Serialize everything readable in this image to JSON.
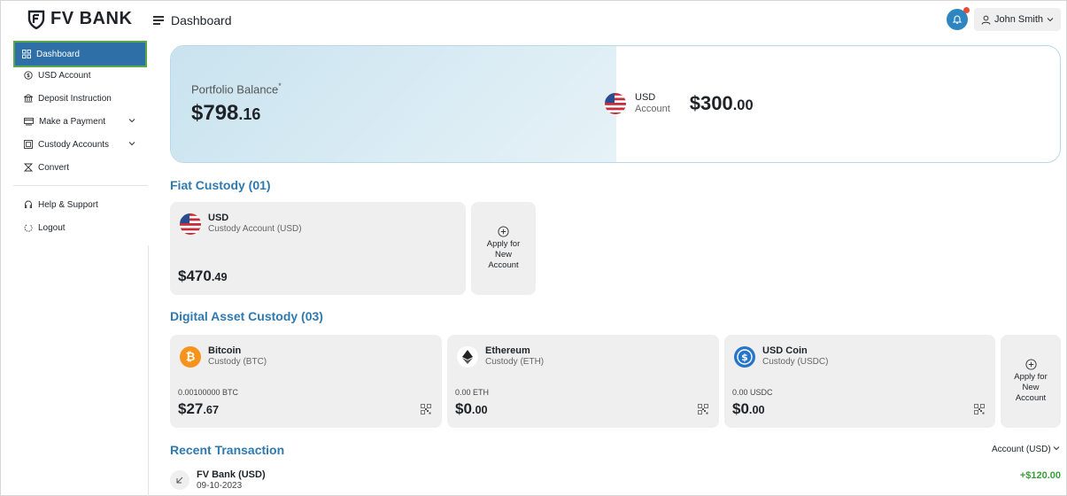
{
  "brand": {
    "name": "FV BANK"
  },
  "header": {
    "page_title": "Dashboard",
    "user_name": "John Smith"
  },
  "sidebar": {
    "items": [
      {
        "label": "Dashboard",
        "icon": "grid-icon",
        "active": true
      },
      {
        "label": "USD Account",
        "icon": "dollar-circle-icon"
      },
      {
        "label": "Deposit Instruction",
        "icon": "bank-icon"
      },
      {
        "label": "Make a Payment",
        "icon": "payment-icon",
        "has_children": true
      },
      {
        "label": "Custody Accounts",
        "icon": "vault-icon",
        "has_children": true
      },
      {
        "label": "Convert",
        "icon": "convert-icon"
      },
      {
        "label": "Help & Support",
        "icon": "headset-icon"
      },
      {
        "label": "Logout",
        "icon": "power-icon"
      }
    ]
  },
  "portfolio": {
    "label": "Portfolio Balance",
    "asterisk": "*",
    "value_main": "$798",
    "value_cents": ".16",
    "usd_title": "USD",
    "usd_sub": "Account",
    "usd_main": "$300",
    "usd_cents": ".00"
  },
  "fiat": {
    "title": "Fiat Custody (01)",
    "card": {
      "title": "USD",
      "subtitle": "Custody Account (USD)",
      "amount_main": "$470",
      "amount_cents": ".49"
    },
    "apply_label": "Apply for New Account"
  },
  "digital": {
    "title": "Digital Asset Custody (03)",
    "cards": [
      {
        "title": "Bitcoin",
        "subtitle": "Custody (BTC)",
        "balance": "0.00100000 BTC",
        "amount_main": "$27",
        "amount_cents": ".67",
        "icon": "bitcoin-icon",
        "color": "#f7931a"
      },
      {
        "title": "Ethereum",
        "subtitle": "Custody (ETH)",
        "balance": "0.00 ETH",
        "amount_main": "$0",
        "amount_cents": ".00",
        "icon": "ethereum-icon",
        "color": "#ffffff"
      },
      {
        "title": "USD Coin",
        "subtitle": "Custody (USDC)",
        "balance": "0.00 USDC",
        "amount_main": "$0",
        "amount_cents": ".00",
        "icon": "usdc-icon",
        "color": "#2775ca"
      }
    ],
    "apply_label": "Apply for New Account"
  },
  "transactions": {
    "title": "Recent Transaction",
    "filter": "Account (USD)",
    "rows": [
      {
        "name": "FV Bank (USD)",
        "date": "09-10-2023",
        "amount": "+$120.00"
      }
    ]
  },
  "colors": {
    "accent": "#2e6fa7",
    "section_title": "#2e7ab0",
    "positive": "#3a9d3a",
    "card_bg": "#efefef"
  }
}
